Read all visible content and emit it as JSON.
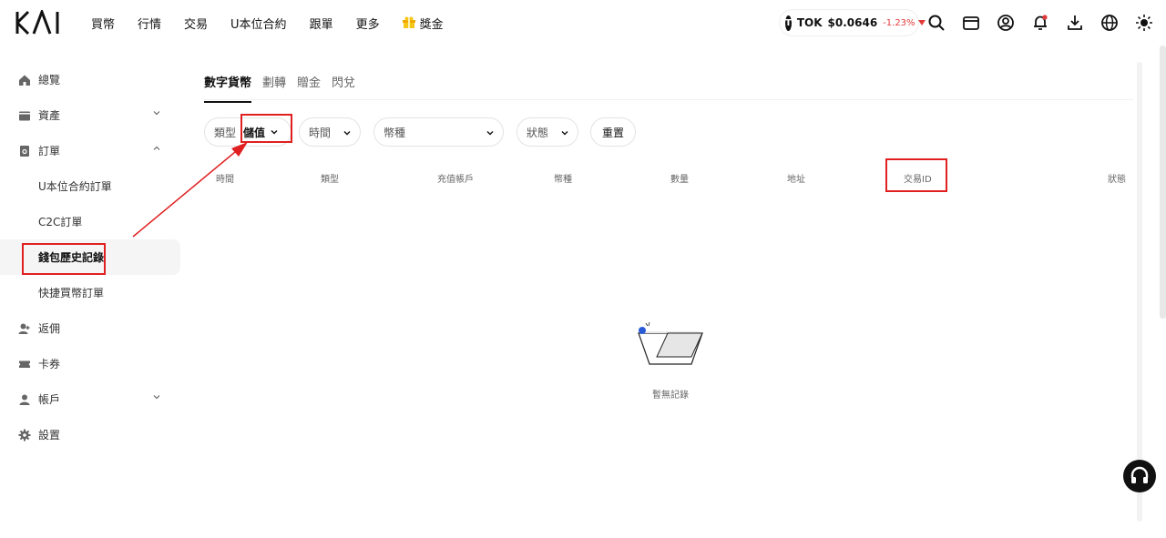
{
  "brand": {
    "logo_text": "KAI"
  },
  "nav": {
    "items": [
      {
        "label": "買幣"
      },
      {
        "label": "行情"
      },
      {
        "label": "交易"
      },
      {
        "label": "U本位合約"
      },
      {
        "label": "跟單"
      },
      {
        "label": "更多"
      },
      {
        "label": "獎金",
        "icon": "gift-icon"
      }
    ]
  },
  "ticker": {
    "symbol": "TOK",
    "logo_letter": "T",
    "price": "$0.0646",
    "change": "-1.23%",
    "change_color": "#e23a3a"
  },
  "sidebar": {
    "items": [
      {
        "label": "總覽",
        "icon": "home-icon"
      },
      {
        "label": "資產",
        "icon": "wallet-icon",
        "expandable": true
      },
      {
        "label": "訂單",
        "icon": "order-icon",
        "expanded": true
      },
      {
        "label": "U本位合約訂單",
        "sub": true
      },
      {
        "label": "C2C訂單",
        "sub": true
      },
      {
        "label": "錢包歷史記錄",
        "sub": true,
        "active": true
      },
      {
        "label": "快捷買幣訂單",
        "sub": true
      },
      {
        "label": "返佣",
        "icon": "referral-icon"
      },
      {
        "label": "卡券",
        "icon": "ticket-icon"
      },
      {
        "label": "帳戶",
        "icon": "user-icon",
        "expandable": true
      },
      {
        "label": "設置",
        "icon": "gear-icon"
      }
    ]
  },
  "tabs": [
    {
      "label": "數字貨幣",
      "active": true
    },
    {
      "label": "劃轉"
    },
    {
      "label": "贈金"
    },
    {
      "label": "閃兌"
    }
  ],
  "filters": {
    "type_label": "類型",
    "type_value": "儲值",
    "time_placeholder": "時間",
    "coin_placeholder": "幣種",
    "status_placeholder": "狀態",
    "reset_label": "重置"
  },
  "table": {
    "headers": [
      "時間",
      "類型",
      "充值帳戶",
      "幣種",
      "數量",
      "地址",
      "交易ID",
      "狀態"
    ]
  },
  "empty": {
    "text": "暫無記錄"
  },
  "colors": {
    "accent": "#111111",
    "annotation": "#e02020",
    "negative": "#e23a3a"
  }
}
